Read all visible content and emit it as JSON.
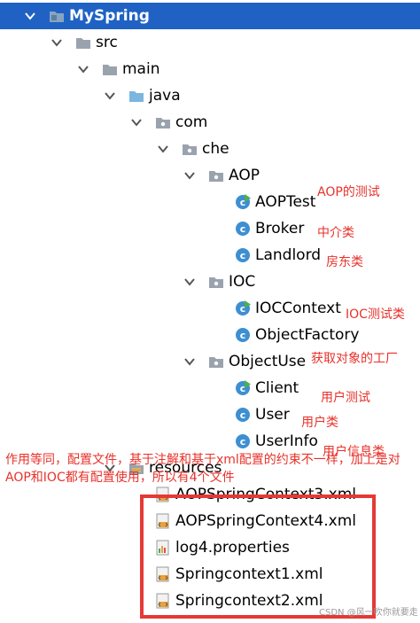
{
  "tree": {
    "root": {
      "label": "MySpring",
      "icon": "module-folder-icon"
    },
    "items": [
      {
        "label": "src",
        "icon": "folder-icon",
        "kind": "folder"
      },
      {
        "label": "main",
        "icon": "folder-icon",
        "kind": "folder"
      },
      {
        "label": "java",
        "icon": "source-folder-icon",
        "kind": "source"
      },
      {
        "label": "com",
        "icon": "package-icon",
        "kind": "package"
      },
      {
        "label": "che",
        "icon": "package-icon",
        "kind": "package"
      },
      {
        "label": "AOP",
        "icon": "package-icon",
        "kind": "package"
      },
      {
        "label": "AOPTest",
        "icon": "class-runnable-icon",
        "kind": "class"
      },
      {
        "label": "Broker",
        "icon": "class-icon",
        "kind": "class"
      },
      {
        "label": "Landlord",
        "icon": "class-icon",
        "kind": "class"
      },
      {
        "label": "IOC",
        "icon": "package-icon",
        "kind": "package"
      },
      {
        "label": "IOCContext",
        "icon": "class-runnable-icon",
        "kind": "class"
      },
      {
        "label": "ObjectFactory",
        "icon": "class-icon",
        "kind": "class"
      },
      {
        "label": "ObjectUse",
        "icon": "package-icon",
        "kind": "package"
      },
      {
        "label": "Client",
        "icon": "class-runnable-icon",
        "kind": "class"
      },
      {
        "label": "User",
        "icon": "class-icon",
        "kind": "class"
      },
      {
        "label": "UserInfo",
        "icon": "class-icon",
        "kind": "class"
      },
      {
        "label": "resources",
        "icon": "resources-folder-icon",
        "kind": "folder"
      },
      {
        "label": "AOPSpringContext3.xml",
        "icon": "xml-file-icon",
        "kind": "file"
      },
      {
        "label": "AOPSpringContext4.xml",
        "icon": "xml-file-icon",
        "kind": "file"
      },
      {
        "label": "log4.properties",
        "icon": "properties-file-icon",
        "kind": "file"
      },
      {
        "label": "Springcontext1.xml",
        "icon": "xml-file-icon",
        "kind": "file"
      },
      {
        "label": "Springcontext2.xml",
        "icon": "xml-file-icon",
        "kind": "file"
      }
    ]
  },
  "annotations": {
    "aop_test": "AOP的测试",
    "broker": "中介类",
    "landlord": "房东类",
    "ioc_test": "IOC测试类",
    "object_factory": "获取对象的工厂",
    "client": "用户测试",
    "user": "用户类",
    "user_info": "用户信息类",
    "config_note": "作用等同，配置文件，基于注解和基于xml配置的约束不一样，加上是对AOP和IOC都有配置使用，所以有4个文件"
  },
  "watermark": "CSDN @风一吹你就要走",
  "colors": {
    "selection": "#1f62c4",
    "annotation": "#e8312a",
    "box": "#e53935",
    "class_icon": "#3d8fd1",
    "runnable_badge": "#4caf50"
  }
}
